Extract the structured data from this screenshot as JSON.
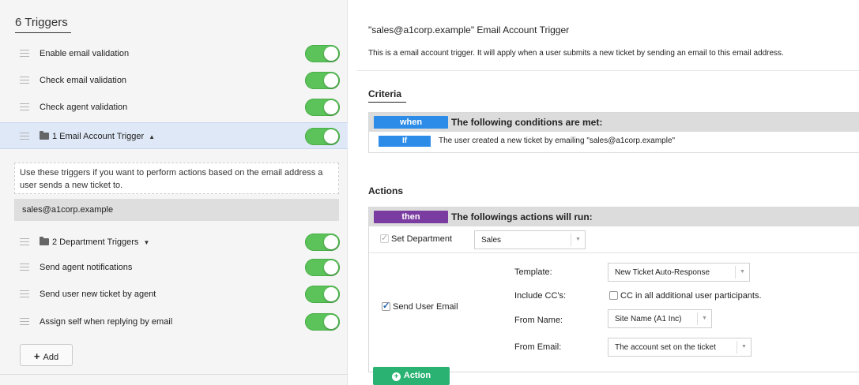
{
  "sidebar": {
    "title": "6 Triggers",
    "triggers": [
      {
        "label": "Enable email validation"
      },
      {
        "label": "Check email validation"
      },
      {
        "label": "Check agent validation"
      },
      {
        "label": "1 Email Account Trigger"
      },
      {
        "label": "2 Department Triggers"
      },
      {
        "label": "Send agent notifications"
      },
      {
        "label": "Send user new ticket by agent"
      },
      {
        "label": "Assign self when replying by email"
      }
    ],
    "group_description": "Use these triggers if you want to perform actions based on the email address a user sends a new ticket to.",
    "group_item": "sales@a1corp.example",
    "add_label": "Add",
    "colors": {
      "toggle_on": "#5cc25a",
      "selected_row": "#dfe8f7"
    }
  },
  "detail": {
    "title": "\"sales@a1corp.example\" Email Account Trigger",
    "description": "This is a email account trigger. It will apply when a user submits a new ticket by sending an email to this email address.",
    "criteria": {
      "heading": "Criteria",
      "when_label": "when",
      "conditions_text": "The following conditions are met:",
      "if_label": "If",
      "condition": "The user created a new ticket by emailing \"sales@a1corp.example\""
    },
    "actions": {
      "heading": "Actions",
      "then_label": "then",
      "actions_text": "The followings actions will run:",
      "set_department_label": "Set Department",
      "department_value": "Sales",
      "send_user_email_label": "Send User Email",
      "template_label": "Template:",
      "template_value": "New Ticket Auto-Response",
      "include_cc_label": "Include CC's:",
      "include_cc_option": "CC in all additional user participants.",
      "from_name_label": "From Name:",
      "from_name_value": "Site Name (A1 Inc)",
      "from_email_label": "From Email:",
      "from_email_value": "The account set on the ticket",
      "add_action_label": "Action"
    },
    "colors": {
      "when_pill": "#2d8ce8",
      "then_pill": "#7a3ca0",
      "action_button": "#2ab272"
    }
  }
}
